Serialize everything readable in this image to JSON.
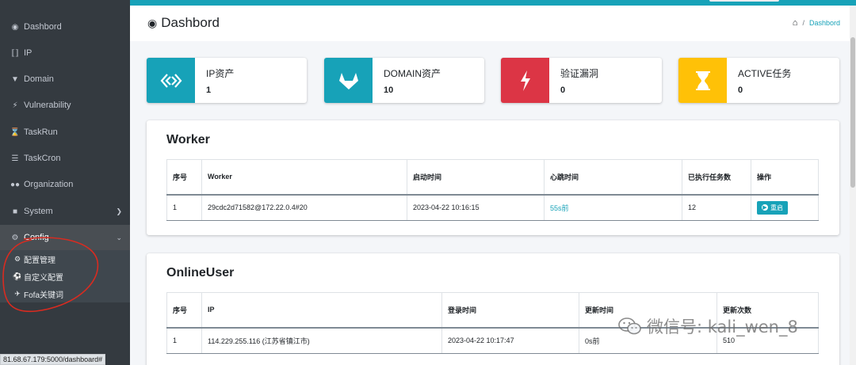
{
  "sidebar": {
    "items": [
      {
        "label": "Dashbord",
        "icon": "tachometer-icon"
      },
      {
        "label": "IP",
        "icon": "ip-arrows-icon"
      },
      {
        "label": "Domain",
        "icon": "gitlab-icon"
      },
      {
        "label": "Vulnerability",
        "icon": "bolt-icon"
      },
      {
        "label": "TaskRun",
        "icon": "hourglass-icon"
      },
      {
        "label": "TaskCron",
        "icon": "list-icon"
      },
      {
        "label": "Organization",
        "icon": "users-icon"
      },
      {
        "label": "System",
        "icon": "user-secret-icon"
      },
      {
        "label": "Config",
        "icon": "cogs-icon"
      }
    ],
    "sub_items": [
      {
        "label": "配置管理",
        "icon": "gear-icon"
      },
      {
        "label": "自定义配置",
        "icon": "soccer-ball-icon"
      },
      {
        "label": "Fofa关键词",
        "icon": "plane-icon"
      }
    ],
    "status_url": "81.68.67.179:5000/dashboard#"
  },
  "header": {
    "title": "Dashbord",
    "breadcrumb_current": "Dashbord"
  },
  "info_boxes": [
    {
      "label": "IP资产",
      "value": "1",
      "color": "#17a2b8",
      "icon": "ip-arrows-icon"
    },
    {
      "label": "DOMAIN资产",
      "value": "10",
      "color": "#17a2b8",
      "icon": "gitlab-icon"
    },
    {
      "label": "验证漏洞",
      "value": "0",
      "color": "#dc3545",
      "icon": "bolt-icon"
    },
    {
      "label": "ACTIVE任务",
      "value": "0",
      "color": "#ffc107",
      "icon": "hourglass-icon"
    }
  ],
  "worker": {
    "title": "Worker",
    "headers": [
      "序号",
      "Worker",
      "启动时间",
      "心跳时间",
      "已执行任务数",
      "操作"
    ],
    "rows": [
      {
        "index": "1",
        "worker": "29cdc2d71582@172.22.0.4#20",
        "start_time": "2023-04-22 10:16:15",
        "heartbeat": "55s前",
        "tasks": "12",
        "action": "重启"
      }
    ]
  },
  "online_user": {
    "title": "OnlineUser",
    "headers": [
      "序号",
      "IP",
      "登录时间",
      "更新时间",
      "更新次数"
    ],
    "rows": [
      {
        "index": "1",
        "ip": "114.229.255.116 (江苏省镇江市)",
        "login_time": "2023-04-22 10:17:47",
        "update_time": "0s前",
        "update_count": "510"
      }
    ]
  },
  "watermark": "微信号: kali_wen_8",
  "colors": {
    "accent": "#17a2b8",
    "danger": "#dc3545",
    "warning": "#ffc107",
    "sidebar": "#343a40"
  }
}
